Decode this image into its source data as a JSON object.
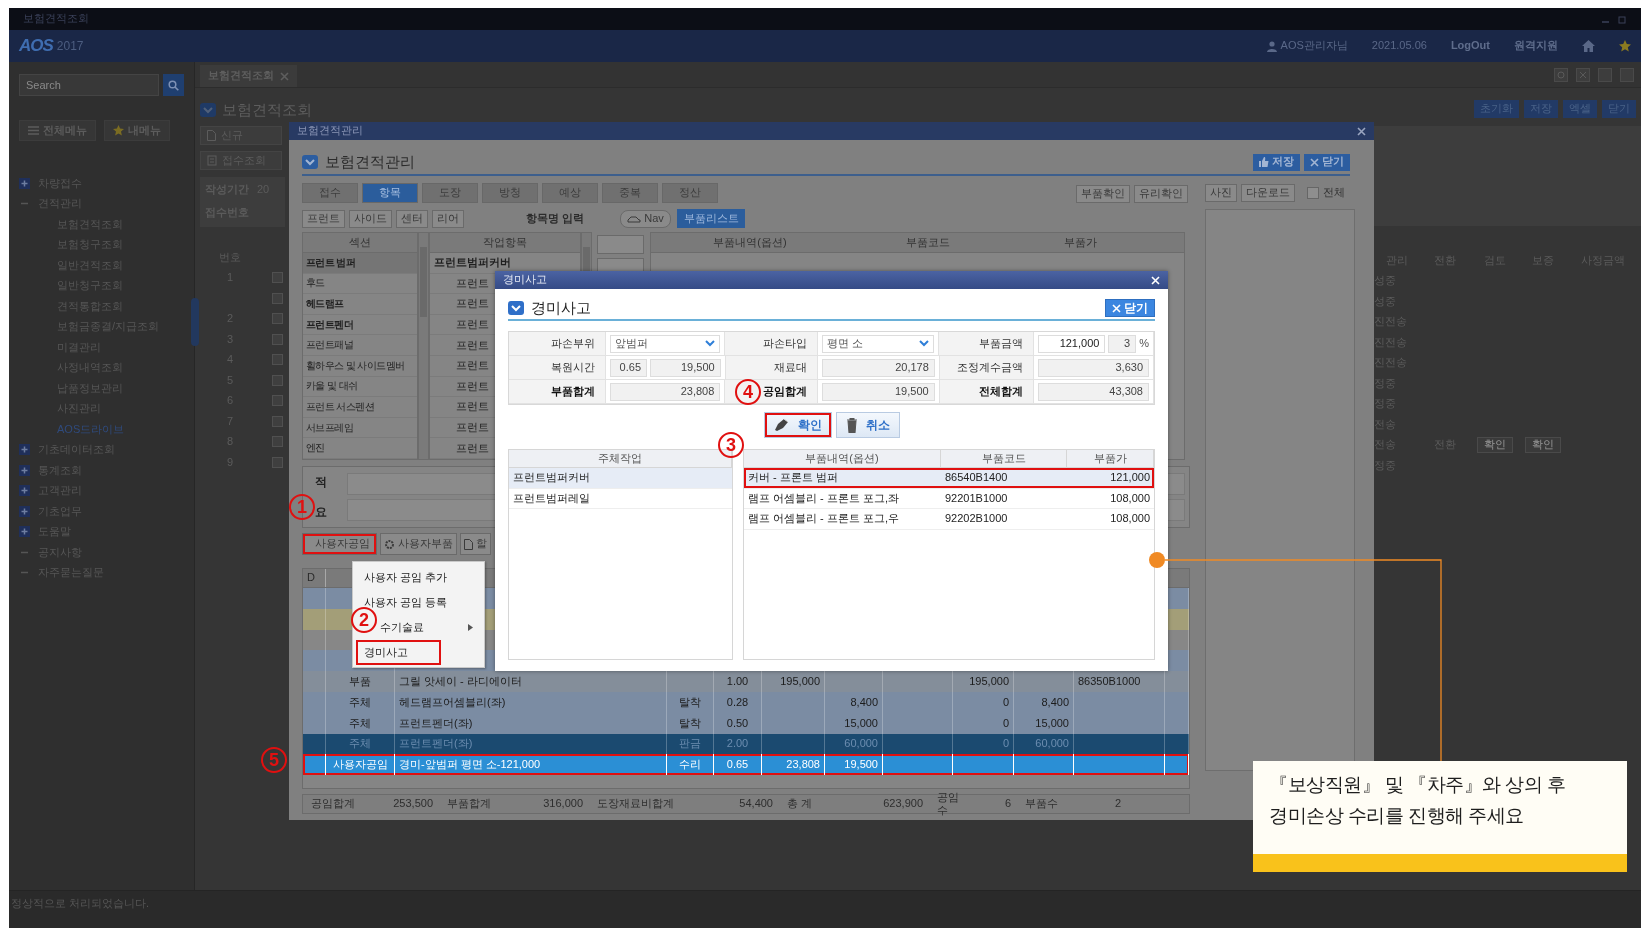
{
  "window": {
    "title": "보험견적조회"
  },
  "header": {
    "logo": "AOS",
    "version": "2017",
    "user": "AOS관리자님",
    "date": "2021.05.06",
    "links": [
      "LogOut",
      "원격지원"
    ]
  },
  "sidebar": {
    "search": {
      "placeholder": "Search"
    },
    "menu_buttons": [
      "전체메뉴",
      "내메뉴"
    ],
    "tree": [
      {
        "label": "차량접수",
        "kind": "folder",
        "expanded": false
      },
      {
        "label": "견적관리",
        "kind": "folder",
        "expanded": true,
        "children": [
          {
            "label": "보험견적조회",
            "selected": false
          },
          {
            "label": "보험청구조회",
            "selected": false
          },
          {
            "label": "일반견적조회",
            "selected": false
          },
          {
            "label": "일반청구조회",
            "selected": false
          },
          {
            "label": "견적통합조회",
            "selected": false
          },
          {
            "label": "보험금종결/지급조회",
            "selected": false
          },
          {
            "label": "미결관리",
            "selected": false
          },
          {
            "label": "사정내역조회",
            "selected": false
          },
          {
            "label": "납품정보관리",
            "selected": false
          },
          {
            "label": "사진관리",
            "selected": false
          },
          {
            "label": "AOS드라이브",
            "selected": true
          }
        ]
      },
      {
        "label": "기초데이터조회",
        "kind": "folder",
        "expanded": false
      },
      {
        "label": "통계조회",
        "kind": "folder",
        "expanded": false
      },
      {
        "label": "고객관리",
        "kind": "folder",
        "expanded": false
      },
      {
        "label": "기초업무",
        "kind": "folder",
        "expanded": false
      },
      {
        "label": "도움말",
        "kind": "folder",
        "expanded": false
      },
      {
        "label": "공지사항",
        "kind": "leaf"
      },
      {
        "label": "자주묻는질문",
        "kind": "leaf"
      }
    ]
  },
  "main_tabs": [
    {
      "label": "보험견적조회",
      "selected": true
    }
  ],
  "page": {
    "title": "보험견적조회",
    "buttons": [
      "신규",
      "접수조회"
    ],
    "filters": [
      {
        "label": "작성기간",
        "value": "20"
      },
      {
        "label": "접수번호"
      }
    ],
    "toolbar": [
      "초기화",
      "저장",
      "엑셀",
      "닫기"
    ],
    "list": {
      "number_header": "번호",
      "columns": [
        "관리",
        "전환",
        "검토",
        "보증",
        "사정금액"
      ],
      "rows": [
        {
          "number": "1",
          "state": "성중",
          "checked": false
        },
        {
          "state": "성중",
          "checked": false
        },
        {
          "number": "2",
          "state": "진전송",
          "checked": false
        },
        {
          "number": "3",
          "state": "진전송",
          "checked": false
        },
        {
          "number": "4",
          "state": "진전송",
          "checked": false
        },
        {
          "number": "5",
          "state": "정중",
          "checked": false
        },
        {
          "number": "6",
          "state": "정중",
          "checked": false
        },
        {
          "number": "7",
          "state": "전송",
          "checked": false
        },
        {
          "number": "8",
          "state": "전송",
          "checked": false,
          "switch": "전환",
          "actions": [
            "확인",
            "확인"
          ]
        },
        {
          "number": "9",
          "state": "정중",
          "checked": false
        }
      ]
    }
  },
  "editor": {
    "title": "보험견적관리",
    "heading": "보험견적관리",
    "buttons": [
      "저장",
      "닫기"
    ],
    "tabs": [
      {
        "label": "접수",
        "selected": false
      },
      {
        "label": "항목",
        "selected": true
      },
      {
        "label": "도장",
        "selected": false
      },
      {
        "label": "방청",
        "selected": false
      },
      {
        "label": "예상",
        "selected": false
      },
      {
        "label": "중복",
        "selected": false
      },
      {
        "label": "정산",
        "selected": false
      }
    ],
    "check_buttons": [
      "부품확인",
      "유리확인"
    ],
    "photo_buttons": [
      "사진",
      "다운로드"
    ],
    "show_all": {
      "label": "전체",
      "checked": false
    },
    "position_buttons": [
      "프런트",
      "사이드",
      "센터",
      "리어"
    ],
    "item_name_label": "항목명 입력",
    "nav_button": "Nav",
    "parts_tab": "부품리스트",
    "sections": {
      "header": "섹션",
      "items": [
        {
          "label": "프런트 범퍼",
          "selected": true,
          "emphasized": true
        },
        {
          "label": "후드",
          "selected": false,
          "emphasized": false
        },
        {
          "label": "헤드램프",
          "selected": false,
          "emphasized": true
        },
        {
          "label": "프런트펜더",
          "selected": false,
          "emphasized": true
        },
        {
          "label": "프런트패널",
          "selected": false,
          "emphasized": false
        },
        {
          "label": "휠하우스 및 사이드멤버",
          "selected": false,
          "emphasized": false
        },
        {
          "label": "카울 및 대쉬",
          "selected": false,
          "emphasized": false
        },
        {
          "label": "프런트 서스펜션",
          "selected": false,
          "emphasized": false
        },
        {
          "label": "서브프레임",
          "selected": false,
          "emphasized": false
        },
        {
          "label": "엔진",
          "selected": false,
          "emphasized": false
        }
      ]
    },
    "tasks": {
      "header": "작업항목",
      "items": [
        {
          "label": "프런트범퍼커버",
          "kind": "group"
        },
        {
          "label": "프런트",
          "kind": "sub"
        },
        {
          "label": "프런트",
          "kind": "sub"
        },
        {
          "label": "프런트",
          "kind": "sub"
        },
        {
          "label": "프런트",
          "kind": "sub"
        },
        {
          "label": "프런트",
          "kind": "sub"
        },
        {
          "label": "프런트",
          "kind": "sub"
        },
        {
          "label": "프런트",
          "kind": "sub"
        },
        {
          "label": "프런트",
          "kind": "sub"
        },
        {
          "label": "프런트",
          "kind": "sub"
        }
      ]
    },
    "parts_columns": [
      "부품내역(옵션)",
      "부품코드",
      "부품가"
    ],
    "memo_labels": [
      "적",
      "요"
    ],
    "toolbar": [
      {
        "label": "사용자공임",
        "kind": "plain",
        "highlighted": true
      },
      {
        "label": "사용자부품",
        "kind": "gear",
        "highlighted": false
      },
      {
        "label": "할",
        "kind": "document",
        "highlighted": false
      }
    ],
    "grid": {
      "header": "D",
      "rows": [
        {
          "color": "#7b8ca3",
          "selected": false,
          "highlighted": false
        },
        {
          "color": "#a39e78",
          "selected": false,
          "highlighted": false
        },
        {
          "color": "#878787",
          "selected": false,
          "highlighted": false
        },
        {
          "color": "#7b8ca3",
          "selected": false,
          "highlighted": false
        },
        {
          "color": "#848e9a",
          "selected": false,
          "highlighted": false,
          "type": "부품",
          "item": "그릴 앗세이 - 라디에이터",
          "quantity": "1.00",
          "column_5": "195,000",
          "column_8": "195,000",
          "column_10": "86350B1000"
        },
        {
          "color": "#7b8ca3",
          "selected": false,
          "highlighted": false,
          "type": "주체",
          "item": "헤드램프어셈블리(좌)",
          "work": "탈착",
          "quantity": "0.28",
          "column_6": "8,400",
          "column_8": "0",
          "column_9": "8,400"
        },
        {
          "color": "#7b8ca3",
          "selected": false,
          "highlighted": false,
          "type": "주체",
          "item": "프런트펜더(좌)",
          "work": "탈착",
          "quantity": "0.50",
          "column_6": "15,000",
          "column_8": "0",
          "column_9": "15,000"
        },
        {
          "color": "#1b4a70",
          "selected": false,
          "highlighted": false,
          "type": "주체",
          "item": "프런트펜더(좌)",
          "work": "판금",
          "quantity": "2.00",
          "column_6": "60,000",
          "column_8": "0",
          "column_9": "60,000"
        },
        {
          "color": "#2b8fd5",
          "selected": true,
          "highlighted": true,
          "type": "사용자공임",
          "item": "경미-앞범퍼 평면 소-121,000",
          "work": "수리",
          "quantity": "0.65",
          "column_5": "23,808",
          "column_6": "19,500"
        }
      ]
    },
    "totals": [
      {
        "label": "공임합계",
        "value": "253,500"
      },
      {
        "label": "부품합계",
        "value": "316,000"
      },
      {
        "label": "도장재료비합계",
        "value": "54,400"
      },
      {
        "label": "총 계",
        "value": "623,900"
      },
      {
        "label": "공임수",
        "value": "6"
      },
      {
        "label": "부품수",
        "value": "2"
      }
    ]
  },
  "context_menu": {
    "items": [
      {
        "label": "사용자 공임 추가",
        "submenu": false,
        "highlighted": false
      },
      {
        "label": "사용자 공임 등록",
        "submenu": false,
        "highlighted": false
      },
      {
        "label": "수기술료",
        "submenu": true,
        "highlighted": false
      },
      {
        "label": "경미사고",
        "submenu": false,
        "highlighted": true
      }
    ]
  },
  "dialog": {
    "title": "경미사고",
    "heading": "경미사고",
    "close_button": "닫기",
    "form_rows": [
      [
        {
          "label": "파손부위",
          "kind": "select",
          "value": "앞범퍼",
          "emphasized": false
        },
        {
          "label": "파손타입",
          "kind": "select",
          "value": "평면 소",
          "emphasized": false
        },
        {
          "label": "부품금액",
          "kind": "amount",
          "value": "121,000",
          "rate": "3",
          "unit": "%",
          "emphasized": false
        }
      ],
      [
        {
          "label": "복원시간",
          "kind": "pair",
          "value": "0.65",
          "amount": "19,500",
          "emphasized": false
        },
        {
          "label": "재료대",
          "kind": "readonly",
          "value": "20,178",
          "emphasized": false
        },
        {
          "label": "조정계수금액",
          "kind": "readonly",
          "value": "3,630",
          "emphasized": false
        }
      ],
      [
        {
          "label": "부품합계",
          "kind": "readonly",
          "value": "23,808",
          "emphasized": true
        },
        {
          "label": "공임합계",
          "kind": "readonly",
          "value": "19,500",
          "emphasized": true
        },
        {
          "label": "전체합계",
          "kind": "readonly",
          "value": "43,308",
          "emphasized": true
        }
      ]
    ],
    "actions": [
      {
        "label": "확인",
        "kind": "confirm",
        "highlighted": true
      },
      {
        "label": "취소",
        "kind": "cancel",
        "highlighted": false
      }
    ],
    "body_works": {
      "header": "주체작업",
      "items": [
        {
          "label": "프런트범퍼커버",
          "selected": true
        },
        {
          "label": "프런트범퍼레일",
          "selected": false
        }
      ]
    },
    "parts": {
      "columns": [
        "부품내역(옵션)",
        "부품코드",
        "부품가"
      ],
      "rows": [
        {
          "name": "커버 - 프론트 범퍼",
          "code": "86540B1400",
          "price": "121,000",
          "selected": true,
          "highlighted": true
        },
        {
          "name": "램프 어셈블리 - 프론트 포그,좌",
          "code": "92201B1000",
          "price": "108,000",
          "selected": false,
          "highlighted": false
        },
        {
          "name": "램프 어셈블리 - 프론트 포그,우",
          "code": "92202B1000",
          "price": "108,000",
          "selected": false,
          "highlighted": false
        }
      ]
    }
  },
  "markers": [
    "1",
    "2",
    "3",
    "4",
    "5"
  ],
  "callout": {
    "lines": [
      "『보상직원』 및 『차주』와 상의 후",
      "경미손상 수리를 진행해 주세요"
    ]
  },
  "status_bar": "정상적으로 처리되었습니다."
}
